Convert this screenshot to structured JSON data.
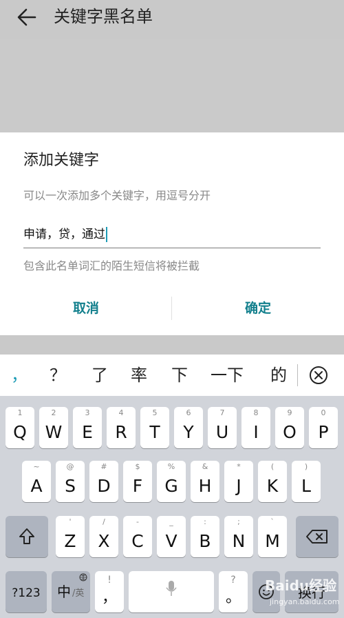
{
  "app_bar": {
    "title": "关键字黑名单",
    "back_icon": "arrow-left-icon"
  },
  "dialog": {
    "title": "添加关键字",
    "hint": "可以一次添加多个关键字，用逗号分开",
    "input_value": "申请，贷，通过",
    "note": "包含此名单词汇的陌生短信将被拦截",
    "cancel_label": "取消",
    "ok_label": "确定",
    "accent_color": "#13808d"
  },
  "candidates": {
    "items": [
      "，",
      "？",
      "了",
      "率",
      "下",
      "一下",
      "的"
    ],
    "close_icon": "circle-x-icon"
  },
  "keyboard": {
    "row1": [
      {
        "sub": "1",
        "key": "Q"
      },
      {
        "sub": "2",
        "key": "W"
      },
      {
        "sub": "3",
        "key": "E"
      },
      {
        "sub": "4",
        "key": "R"
      },
      {
        "sub": "5",
        "key": "T"
      },
      {
        "sub": "6",
        "key": "Y"
      },
      {
        "sub": "7",
        "key": "U"
      },
      {
        "sub": "8",
        "key": "I"
      },
      {
        "sub": "9",
        "key": "O"
      },
      {
        "sub": "0",
        "key": "P"
      }
    ],
    "row2": [
      {
        "sub": "~",
        "key": "A"
      },
      {
        "sub": "@",
        "key": "S"
      },
      {
        "sub": "#",
        "key": "D"
      },
      {
        "sub": "$",
        "key": "F"
      },
      {
        "sub": "%",
        "key": "G"
      },
      {
        "sub": "&",
        "key": "H"
      },
      {
        "sub": "*",
        "key": "J"
      },
      {
        "sub": "(",
        "key": "K"
      },
      {
        "sub": ")",
        "key": "L"
      }
    ],
    "row3": [
      {
        "sub": "'",
        "key": "Z"
      },
      {
        "sub": "/",
        "key": "X"
      },
      {
        "sub": "-",
        "key": "C"
      },
      {
        "sub": "_",
        "key": "V"
      },
      {
        "sub": ":",
        "key": "B"
      },
      {
        "sub": ";",
        "key": "N"
      },
      {
        "sub": "`",
        "key": "M"
      }
    ],
    "shift_icon": "shift-arrow-icon",
    "backspace_icon": "backspace-icon",
    "num_key": "?123",
    "lang_key_main": "中",
    "lang_key_sub": "/英",
    "comma_key_sub": "!",
    "comma_key": "，",
    "space_icon": "microphone-icon",
    "period_key_sub": "?",
    "period_key": "。",
    "emoji_icon": "emoji-icon",
    "enter_key": "换行"
  },
  "watermark": {
    "text": "Baidu经验",
    "sub": "jingyan.baidu.com"
  }
}
